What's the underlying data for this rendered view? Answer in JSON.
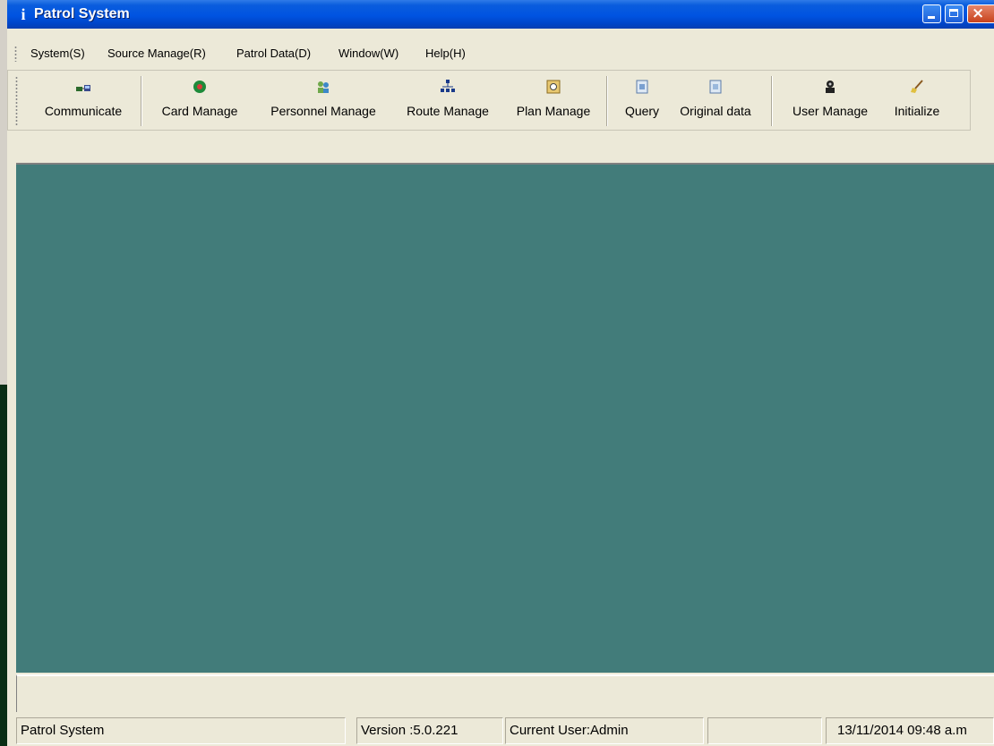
{
  "window": {
    "title": "Patrol System",
    "app_icon": "info-i-icon"
  },
  "menu": [
    {
      "label": "System(S)"
    },
    {
      "label": "Source Manage(R)"
    },
    {
      "label": "Patrol Data(D)"
    },
    {
      "label": "Window(W)"
    },
    {
      "label": "Help(H)"
    }
  ],
  "toolbar": [
    {
      "label": "Communicate",
      "icon": "communicate-icon"
    },
    {
      "label": "Card Manage",
      "icon": "card-icon"
    },
    {
      "label": "Personnel Manage",
      "icon": "personnel-icon"
    },
    {
      "label": "Route Manage",
      "icon": "route-icon"
    },
    {
      "label": "Plan Manage",
      "icon": "plan-icon"
    },
    {
      "label": "Query",
      "icon": "query-icon"
    },
    {
      "label": "Original data",
      "icon": "original-data-icon"
    },
    {
      "label": "User Manage",
      "icon": "user-manage-icon"
    },
    {
      "label": "Initialize",
      "icon": "initialize-icon"
    }
  ],
  "status": {
    "app": "Patrol System",
    "version": "Version :5.0.221",
    "user": "Current User:Admin",
    "empty": "",
    "datetime": "13/11/2014   09:48 a.m"
  },
  "colors": {
    "title_bar": "#0054e3",
    "workspace": "#427c7a",
    "chrome": "#ece9d8"
  }
}
